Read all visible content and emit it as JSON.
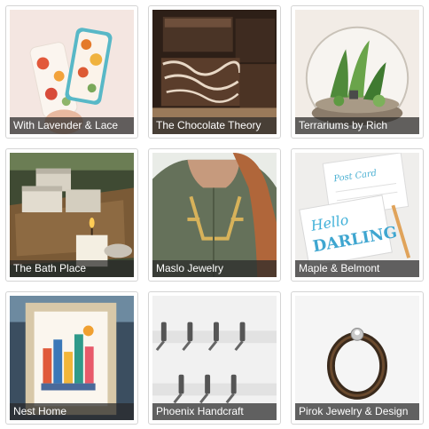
{
  "shops": [
    {
      "name": "With Lavender & Lace",
      "image": "floral-phone-cases"
    },
    {
      "name": "The Chocolate Theory",
      "image": "chocolate-brownies"
    },
    {
      "name": "Terrariums by Rich",
      "image": "glass-terrarium"
    },
    {
      "name": "The Bath Place",
      "image": "candles-in-basket"
    },
    {
      "name": "Maslo Jewelry",
      "image": "gold-necklace"
    },
    {
      "name": "Maple & Belmont",
      "image": "hello-darling-postcards"
    },
    {
      "name": "Nest Home",
      "image": "framed-city-print"
    },
    {
      "name": "Phoenix Handcraft",
      "image": "wall-hooks"
    },
    {
      "name": "Pirok Jewelry & Design",
      "image": "dark-ring"
    }
  ]
}
